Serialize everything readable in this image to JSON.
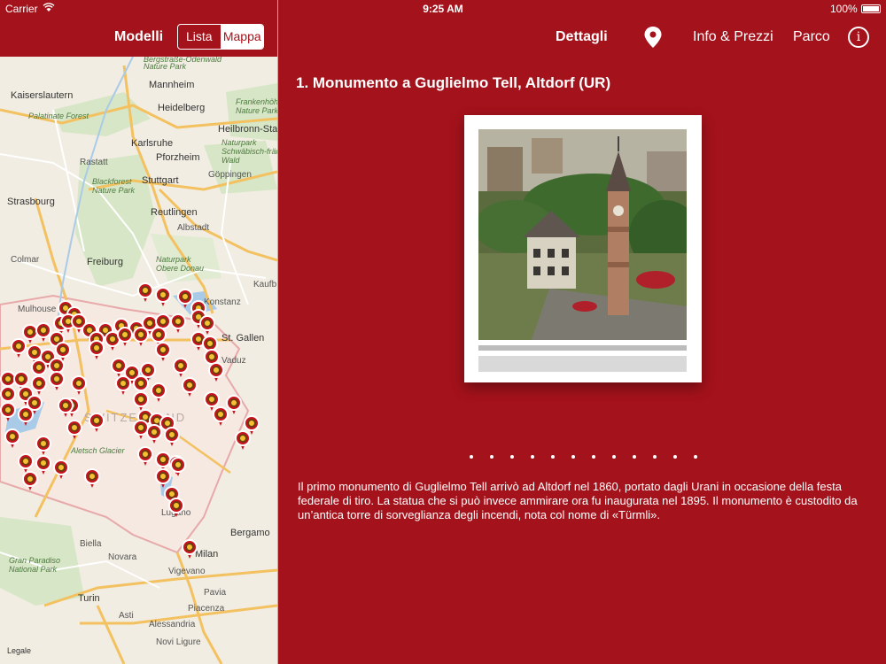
{
  "status_bar": {
    "carrier": "Carrier",
    "time": "9:25 AM",
    "battery": "100%"
  },
  "left_nav": {
    "title": "Modelli",
    "segments": [
      {
        "label": "Lista",
        "selected": false
      },
      {
        "label": "Mappa",
        "selected": true
      }
    ]
  },
  "map": {
    "labels": {
      "bergstrasse": "Bergstraße-Odenwald",
      "nature_park": "Nature Park",
      "kaiserslautern": "Kaiserslautern",
      "mannheim": "Mannheim",
      "palatinate": "Palatinate Forest",
      "heidelberg": "Heidelberg",
      "frankenhohe": "Frankenhöhe",
      "frankenhohe_np": "Nature Park",
      "heilbronn": "Heilbronn-Stanzen",
      "karlsruhe": "Karlsruhe",
      "np_swab": "Naturpark",
      "np_swab2": "Schwäbisch-fränk",
      "np_swab3": "Wald",
      "rastatt": "Rastatt",
      "pforzheim": "Pforzheim",
      "blackforest": "Blackforest",
      "blackforest2": "Nature Park",
      "stuttgart": "Stuttgart",
      "goppingen": "Göppingen",
      "strasbourg": "Strasbourg",
      "reutlingen": "Reutlingen",
      "albstadt": "Albstadt",
      "colmar": "Colmar",
      "freiburg": "Freiburg",
      "np_donau": "Naturpark",
      "np_donau2": "Obere Donau",
      "kaufbeuren": "Kaufb",
      "konstanz": "Konstanz",
      "mulhouse": "Mulhouse",
      "st_gallen": "St. Gallen",
      "vaduz": "Vaduz",
      "switzerland": "SWITZERLAND",
      "aletsch": "Aletsch Glacier",
      "lugano": "Lugano",
      "bergamo": "Bergamo",
      "biella": "Biella",
      "milan": "Milan",
      "gran_paradiso": "Gran Paradiso",
      "gran_paradiso2": "National Park",
      "novara": "Novara",
      "vigevano": "Vigevano",
      "turin": "Turin",
      "asti": "Asti",
      "piacenza": "Piacenza",
      "pavia": "Pavia",
      "alessandria": "Alessandria",
      "novi_ligure": "Novi Ligure",
      "legal": "Legale"
    }
  },
  "right_nav": {
    "details": "Dettagli",
    "location_icon": "map-pin-icon",
    "info_prices": "Info & Prezzi",
    "park": "Parco",
    "about_icon": "i"
  },
  "detail": {
    "title": "1. Monumento a Guglielmo Tell, Altdorf (UR)",
    "page_count": 12,
    "description": "Il primo monumento di Guglielmo Tell arrivò ad Altdorf nel 1860, portato dagli Urani in occasione della festa federale di tiro. La statua che si può invece ammirare ora fu inaugurata nel 1895. Il monumento è custodito da un’antica torre di sorveglianza degli incendi, nota col nome di «Türmli»."
  },
  "colors": {
    "brand_red": "#a4121b",
    "pin_red": "#c8121c",
    "pin_yellow": "#f4c230"
  }
}
